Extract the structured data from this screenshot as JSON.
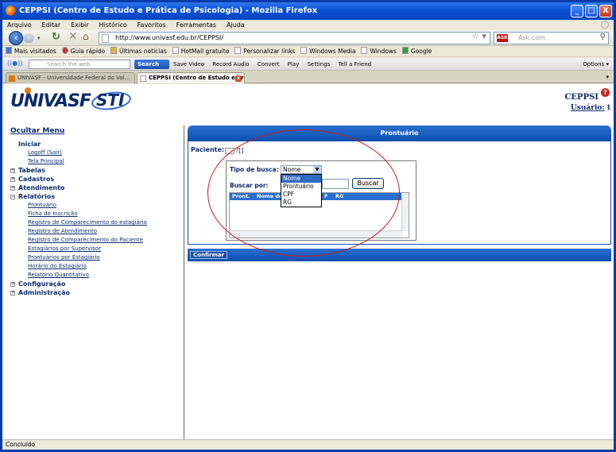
{
  "window": {
    "title": "CEPPSI (Centro de Estudo e Prática de Psicologia) - Mozilla Firefox",
    "minimize": "_",
    "maximize": "□",
    "close": "X"
  },
  "menu": [
    "Arquivo",
    "Editar",
    "Exibir",
    "Histórico",
    "Favoritos",
    "Ferramentas",
    "Ajuda"
  ],
  "navbar": {
    "url": "http://www.univasf.edu.br/CEPPSI/",
    "search_placeholder": "Ask.com"
  },
  "bookmarks": [
    "Mais visitados",
    "Guia rápido",
    "Últimas notícias",
    "HotMail gratuito",
    "Personalizar links",
    "Windows Media",
    "Windows",
    "Google"
  ],
  "asktoolbar": {
    "search_placeholder": "Search the web",
    "search_button": "Search",
    "items": [
      "Save Video",
      "Record Audio",
      "Convert",
      "Play",
      "Settings",
      "Tell a Friend"
    ],
    "options": "Options"
  },
  "tabs": [
    {
      "label": "UNIVASF - Universidade Federal do Val..."
    },
    {
      "label": "CEPPSI (Centro de Estudo e Práti..."
    }
  ],
  "header": {
    "logo_text": "UNIVASF",
    "logo2_text": "STI",
    "app_name": "CEPPSI",
    "user_label": "Usuário:",
    "user_value": "t"
  },
  "sidebar": {
    "toggle": "Ocultar Menu",
    "iniciar": "Iniciar",
    "iniciar_items": [
      "Logoff (Sair)",
      "Tela Principal"
    ],
    "tabelas": "Tabelas",
    "cadastros": "Cadastros",
    "atendimento": "Atendimento",
    "relatorios": "Relatórios",
    "relatorios_items": [
      "Prontuário",
      "Ficha de Inscrição",
      "Registro de Comparecimento do estagiário",
      "Registro de Atendimento",
      "Registro de Comparecimento do Paciente",
      "Estagiários por Supervisor",
      "Prontuários por Estagiário",
      "Horário do Estagiário",
      "Relatório Quantitativo"
    ],
    "configuracao": "Configuração",
    "administracao": "Administração"
  },
  "main": {
    "title": "Prontuário",
    "paciente_label": "Paciente:",
    "paciente_value": "?[]",
    "tipo_label": "Tipo de busca:",
    "tipo_selected": "Nome",
    "tipo_options": [
      "Nome",
      "Prontuário",
      "CPF",
      "RG"
    ],
    "buscar_label": "Buscar por:",
    "buscar_button": "Buscar",
    "results_columns": [
      "Pront.",
      "Nome do",
      "F",
      "RG"
    ],
    "confirm_button": "Confirmar"
  },
  "status": "Concluído"
}
